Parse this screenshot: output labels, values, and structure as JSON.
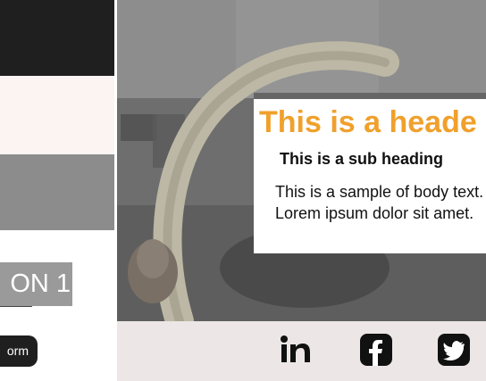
{
  "sidebar": {
    "option_label": "ON 1",
    "form_button_label": "orm"
  },
  "card": {
    "header": "This is a heade",
    "subheading": "This is a sub heading",
    "body": "This is a sample of body text. Lorem ipsum dolor sit amet."
  },
  "footer": {
    "icons": [
      "linkedin-icon",
      "facebook-icon",
      "twitter-icon"
    ]
  },
  "colors": {
    "header_accent": "#f0a02c",
    "dark_block": "#1f1f1f",
    "footer_bg": "#ece6e6"
  }
}
